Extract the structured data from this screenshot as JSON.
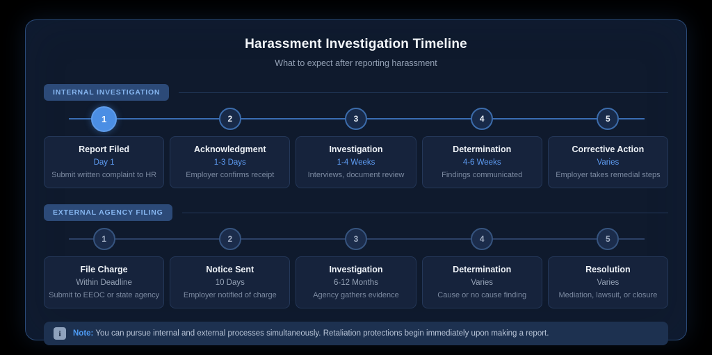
{
  "title": "Harassment Investigation Timeline",
  "subtitle": "What to expect after reporting harassment",
  "sections": [
    {
      "label": "INTERNAL INVESTIGATION",
      "active_step": 1,
      "steps": [
        {
          "number": "1",
          "title": "Report Filed",
          "duration": "Day 1",
          "description": "Submit written complaint to HR"
        },
        {
          "number": "2",
          "title": "Acknowledgment",
          "duration": "1-3 Days",
          "description": "Employer confirms receipt"
        },
        {
          "number": "3",
          "title": "Investigation",
          "duration": "1-4 Weeks",
          "description": "Interviews, document review"
        },
        {
          "number": "4",
          "title": "Determination",
          "duration": "4-6 Weeks",
          "description": "Findings communicated"
        },
        {
          "number": "5",
          "title": "Corrective Action",
          "duration": "Varies",
          "description": "Employer takes remedial steps"
        }
      ]
    },
    {
      "label": "EXTERNAL AGENCY FILING",
      "active_step": 0,
      "steps": [
        {
          "number": "1",
          "title": "File Charge",
          "duration": "Within Deadline",
          "description": "Submit to EEOC or state agency"
        },
        {
          "number": "2",
          "title": "Notice Sent",
          "duration": "10 Days",
          "description": "Employer notified of charge"
        },
        {
          "number": "3",
          "title": "Investigation",
          "duration": "6-12 Months",
          "description": "Agency gathers evidence"
        },
        {
          "number": "4",
          "title": "Determination",
          "duration": "Varies",
          "description": "Cause or no cause finding"
        },
        {
          "number": "5",
          "title": "Resolution",
          "duration": "Varies",
          "description": "Mediation, lawsuit, or closure"
        }
      ]
    }
  ],
  "note": {
    "icon": "i",
    "label": "Note:",
    "text": "You can pursue internal and external processes simultaneously. Retaliation protections begin immediately upon making a report."
  },
  "colors": {
    "panel_background": "#0f1a2d",
    "panel_border": "#2a4a78",
    "badge_background": "#2c4a78",
    "badge_text": "#85b5ef",
    "active_step": "#4b8ee4",
    "internal_track": "#3a6db3",
    "external_track": "#2c4166",
    "duration_accent": "#5e9cf3",
    "note_background": "#1d3150",
    "note_label": "#4e9bf5"
  }
}
